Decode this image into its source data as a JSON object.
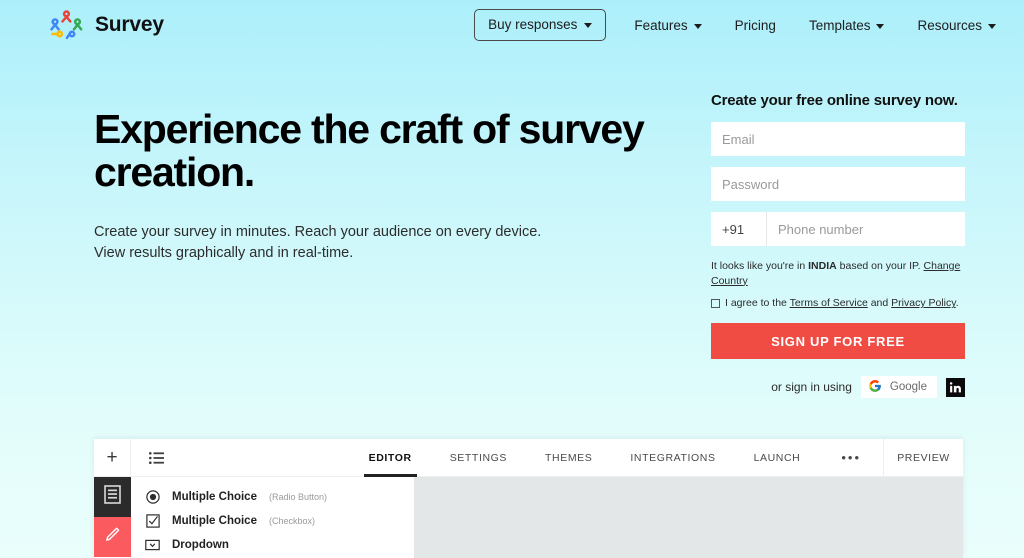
{
  "brand": {
    "name": "Survey",
    "logo_icon": "people-circle-logo"
  },
  "nav": {
    "buy_button": {
      "label": "Buy responses",
      "caret_icon": "caret-down-icon"
    },
    "links": [
      {
        "label": "Features",
        "has_caret": true
      },
      {
        "label": "Pricing",
        "has_caret": false
      },
      {
        "label": "Templates",
        "has_caret": true
      },
      {
        "label": "Resources",
        "has_caret": true
      }
    ]
  },
  "hero": {
    "headline": "Experience the craft of survey creation.",
    "subtext": "Create your survey in minutes. Reach your audience on every device. View results graphically and in real-time."
  },
  "signup": {
    "title": "Create your free online survey now.",
    "email_placeholder": "Email",
    "email_value": "",
    "password_placeholder": "Password",
    "password_value": "",
    "country_code": "+91",
    "phone_placeholder": "Phone number",
    "phone_value": "",
    "ip_note_prefix": "It looks like you're in ",
    "ip_country": "INDIA",
    "ip_note_suffix": " based on your IP. ",
    "change_country_link": "Change Country",
    "terms_prefix": "I agree to the ",
    "terms_link": "Terms of Service",
    "terms_middle": " and ",
    "privacy_link": "Privacy Policy",
    "terms_suffix": ".",
    "terms_checked": false,
    "submit_label": "SIGN UP FOR FREE",
    "social_label": "or sign in using",
    "google_label": "Google",
    "google_icon": "google-g-icon",
    "linkedin_icon": "linkedin-icon",
    "accent_color": "#F04C44"
  },
  "editor": {
    "add_label": "+",
    "list_icon": "list-icon",
    "tabs": [
      {
        "label": "EDITOR",
        "active": true
      },
      {
        "label": "SETTINGS",
        "active": false
      },
      {
        "label": "THEMES",
        "active": false
      },
      {
        "label": "INTEGRATIONS",
        "active": false
      },
      {
        "label": "LAUNCH",
        "active": false
      }
    ],
    "overflow_label": "•••",
    "preview_label": "PREVIEW",
    "rail": [
      {
        "icon": "form-document-icon",
        "color": "#2b2b2b",
        "active": true
      },
      {
        "icon": "pencil-icon",
        "color": "#FB5A5F",
        "active": false
      }
    ],
    "question_types": [
      {
        "icon": "radio-button-icon",
        "label": "Multiple Choice",
        "sub": "(Radio Button)"
      },
      {
        "icon": "checkbox-icon",
        "label": "Multiple Choice",
        "sub": "(Checkbox)"
      },
      {
        "icon": "dropdown-icon",
        "label": "Dropdown",
        "sub": ""
      }
    ]
  }
}
